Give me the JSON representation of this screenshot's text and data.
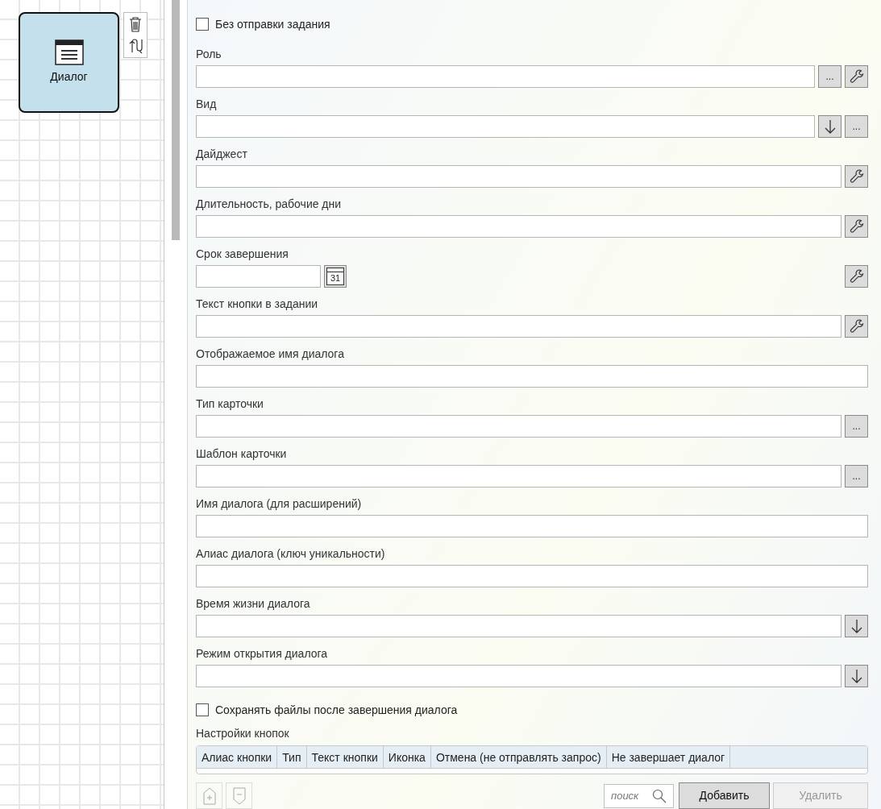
{
  "canvas": {
    "node": {
      "label": "Диалог",
      "selected": true
    }
  },
  "no_send": {
    "label": "Без отправки задания",
    "checked": false
  },
  "fields": [
    {
      "label": "Роль",
      "kind": "text",
      "buttons": [
        {
          "kind": "ellipsis",
          "label": "..."
        },
        {
          "kind": "wrench"
        }
      ]
    },
    {
      "label": "Вид",
      "kind": "text",
      "buttons": [
        {
          "kind": "arrow"
        },
        {
          "kind": "ellipsis",
          "label": "..."
        }
      ]
    },
    {
      "label": "Дайджест",
      "kind": "text",
      "buttons": [
        {
          "kind": "wrench"
        }
      ]
    },
    {
      "label": "Длительность, рабочие дни",
      "kind": "text",
      "buttons": [
        {
          "kind": "wrench"
        }
      ]
    },
    {
      "label": "Срок завершения",
      "kind": "date",
      "calendar_day": "31",
      "buttons": [
        {
          "kind": "wrench"
        }
      ]
    },
    {
      "label": "Текст кнопки в задании",
      "kind": "text",
      "buttons": [
        {
          "kind": "wrench"
        }
      ]
    },
    {
      "label": "Отображаемое имя диалога",
      "kind": "text"
    },
    {
      "label": "Тип карточки",
      "kind": "text",
      "buttons": [
        {
          "kind": "ellipsis",
          "label": "..."
        }
      ]
    },
    {
      "label": "Шаблон карточки",
      "kind": "text",
      "buttons": [
        {
          "kind": "ellipsis",
          "label": "..."
        }
      ]
    },
    {
      "label": "Имя диалога (для расширений)",
      "kind": "text"
    },
    {
      "label": "Алиас диалога (ключ уникальности)",
      "kind": "text"
    },
    {
      "label": "Время жизни диалога",
      "kind": "text",
      "buttons": [
        {
          "kind": "arrow"
        }
      ]
    },
    {
      "label": "Режим открытия диалога",
      "kind": "text",
      "buttons": [
        {
          "kind": "arrow"
        }
      ]
    }
  ],
  "keep_files": {
    "label": "Сохранять файлы после завершения диалога",
    "checked": false
  },
  "buttons_table": {
    "title": "Настройки кнопок",
    "columns": [
      "Алиас кнопки",
      "Тип",
      "Текст кнопки",
      "Иконка",
      "Отмена (не отправлять запрос)",
      "Не завершает диалог"
    ]
  },
  "toolbar": {
    "move_up": {
      "disabled": true
    },
    "move_down": {
      "disabled": true
    },
    "search_placeholder": "поиск",
    "add": {
      "label": "Добавить",
      "disabled": false
    },
    "delete": {
      "label": "Удалить",
      "disabled": true
    }
  }
}
